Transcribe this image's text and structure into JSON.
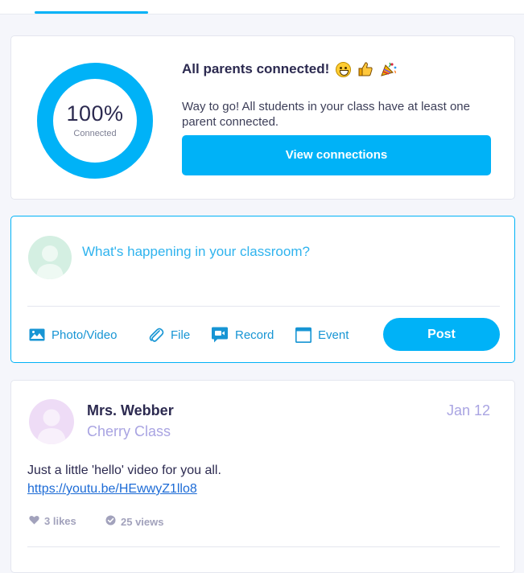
{
  "colors": {
    "accent": "#00b2f7",
    "link": "#1c6bd6",
    "class_label": "#a9a4e2",
    "page_bg": "#f5f6fb"
  },
  "connections": {
    "percent": "100%",
    "percent_value": 100,
    "percent_caption": "Connected",
    "title": "All parents connected!",
    "title_emojis": [
      "grinning-face-icon",
      "thumbs-up-icon",
      "party-popper-icon"
    ],
    "description": "Way to go! All students in your class have at least one parent connected.",
    "button_label": "View connections"
  },
  "composer": {
    "prompt": "What's happening in your classroom?",
    "tools": [
      {
        "label": "Photo/Video",
        "icon": "photo-icon"
      },
      {
        "label": "File",
        "icon": "paperclip-icon"
      },
      {
        "label": "Record",
        "icon": "video-record-icon"
      },
      {
        "label": "Event",
        "icon": "calendar-icon"
      }
    ],
    "post_label": "Post"
  },
  "post": {
    "author": "Mrs. Webber",
    "class_name": "Cherry Class",
    "date": "Jan 12",
    "text": "Just a little 'hello' video for you all.",
    "link": "https://youtu.be/HEwwyZ1llo8",
    "likes": "3 likes",
    "views": "25 views"
  }
}
